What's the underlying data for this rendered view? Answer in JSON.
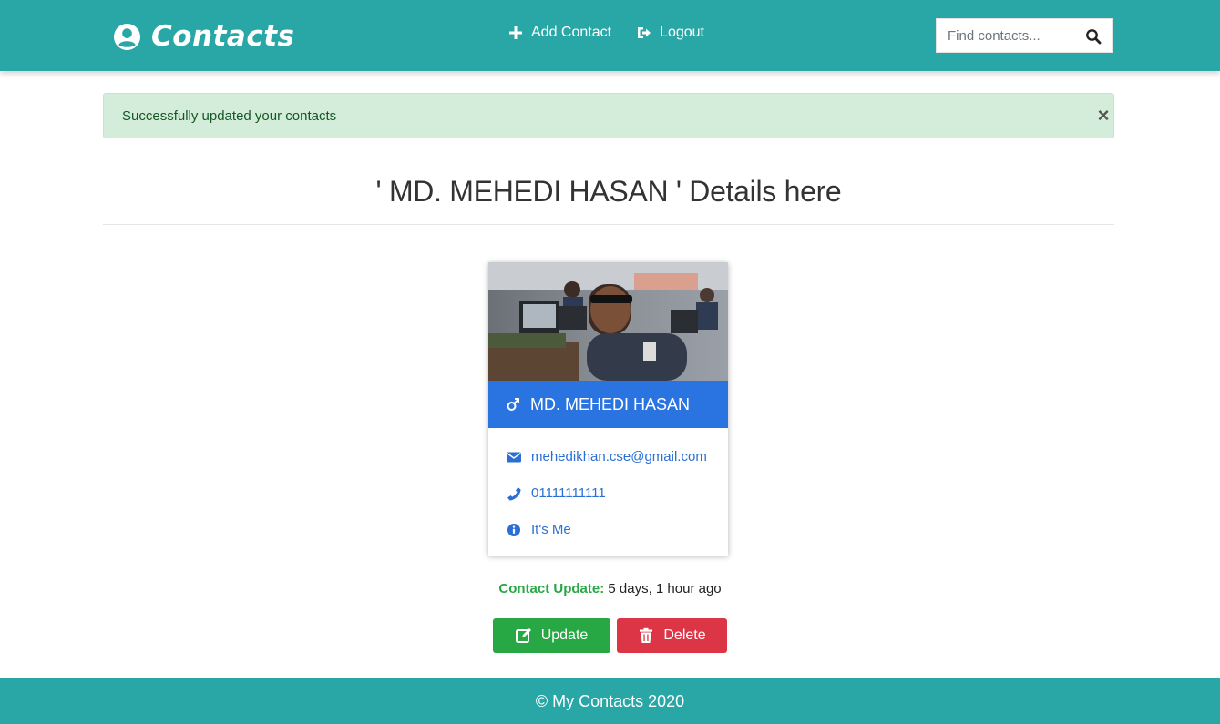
{
  "nav": {
    "brand": "Contacts",
    "add_contact": "Add Contact",
    "logout": "Logout",
    "search_placeholder": "Find contacts..."
  },
  "alert": {
    "message": "Successfully updated your contacts",
    "close": "×"
  },
  "page": {
    "heading": "' MD. MEHEDI HASAN ' Details here"
  },
  "contact": {
    "name": "MD. MEHEDI HASAN",
    "email": "mehedikhan.cse@gmail.com",
    "phone": "01111111111",
    "note": "It's Me",
    "gender_icon": "male-icon"
  },
  "status": {
    "label": "Contact Update:",
    "value": "5 days, 1 hour ago"
  },
  "actions": {
    "update": "Update",
    "delete": "Delete"
  },
  "footer": {
    "text": "© My Contacts 2020"
  },
  "colors": {
    "navbar": "#29a6a6",
    "card_header": "#2a74e2",
    "update": "#28a745",
    "delete": "#dc3545",
    "alert_bg": "#d4edda"
  }
}
